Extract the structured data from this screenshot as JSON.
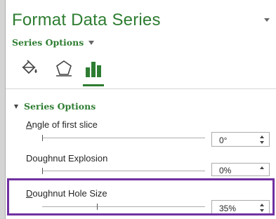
{
  "pane": {
    "title": "Format Data Series",
    "category_dropdown": "Series Options"
  },
  "tabs": [
    {
      "icon": "paint-bucket-icon",
      "name": "Fill & Line"
    },
    {
      "icon": "pentagon-icon",
      "name": "Effects"
    },
    {
      "icon": "bar-chart-icon",
      "name": "Series Options",
      "selected": true
    }
  ],
  "section": {
    "label": "Series Options",
    "expanded": true
  },
  "options": [
    {
      "label_accel": "A",
      "label_rest": "ngle of first slice",
      "value": "0°",
      "slider_fraction": 0.0
    },
    {
      "label_accel": "",
      "label_rest": "Doughnut Explosion",
      "value": "0%",
      "slider_fraction": 0.0
    },
    {
      "label_accel": "D",
      "label_rest": "oughnut Hole Size",
      "value": "35%",
      "slider_fraction": 0.35
    }
  ],
  "colors": {
    "accent": "#2e7d32",
    "highlight": "#7030a0"
  }
}
